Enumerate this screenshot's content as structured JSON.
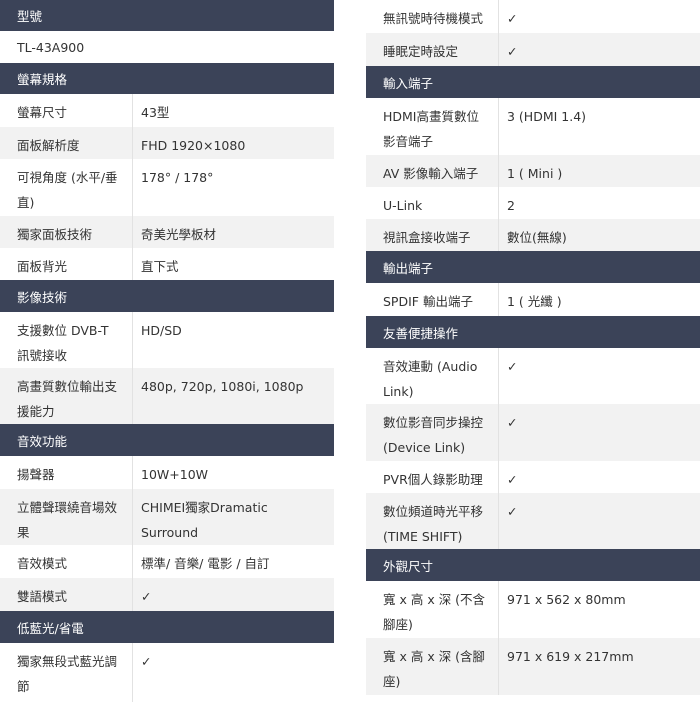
{
  "left": {
    "model": {
      "header": "型號",
      "value": "TL-43A900"
    },
    "sections": [
      {
        "header": "螢幕規格",
        "rows": [
          {
            "label": "螢幕尺寸",
            "value": "43型"
          },
          {
            "label": "面板解析度",
            "value": "FHD 1920×1080"
          },
          {
            "label": "可視角度 (水平/垂直)",
            "value": "178° / 178°"
          },
          {
            "label": "獨家面板技術",
            "value": "奇美光學板材"
          },
          {
            "label": "面板背光",
            "value": "直下式"
          }
        ]
      },
      {
        "header": "影像技術",
        "rows": [
          {
            "label": "支援數位 DVB-T 訊號接收",
            "value": "HD/SD"
          },
          {
            "label": "高畫質數位輸出支援能力",
            "value": "480p, 720p, 1080i, 1080p"
          }
        ]
      },
      {
        "header": "音效功能",
        "rows": [
          {
            "label": "揚聲器",
            "value": "10W+10W"
          },
          {
            "label": "立體聲環繞音場效果",
            "value": "CHIMEI獨家Dramatic Surround"
          },
          {
            "label": "音效模式",
            "value": "標準/ 音樂/ 電影 / 自訂"
          },
          {
            "label": "雙語模式",
            "value": "✓"
          }
        ]
      },
      {
        "header": "低藍光/省電",
        "rows": [
          {
            "label": "獨家無段式藍光調節",
            "value": "✓"
          }
        ]
      }
    ]
  },
  "right": {
    "top_rows": [
      {
        "label": "無訊號時待機模式",
        "value": "✓"
      },
      {
        "label": "睡眠定時設定",
        "value": "✓"
      }
    ],
    "sections": [
      {
        "header": "輸入端子",
        "rows": [
          {
            "label": "HDMI高畫質數位影音端子",
            "value": "3 (HDMI 1.4)"
          },
          {
            "label": "AV 影像輸入端子",
            "value": "1 ( Mini )"
          },
          {
            "label": "U-Link",
            "value": "2"
          },
          {
            "label": "視訊盒接收端子",
            "value": "數位(無線)"
          }
        ]
      },
      {
        "header": "輸出端子",
        "rows": [
          {
            "label": "SPDIF 輸出端子",
            "value": "1 ( 光纖 )"
          }
        ]
      },
      {
        "header": "友善便捷操作",
        "rows": [
          {
            "label": "音效連動 (Audio Link)",
            "value": "✓"
          },
          {
            "label": "數位影音同步操控 (Device Link)",
            "value": "✓"
          },
          {
            "label": "PVR個人錄影助理",
            "value": "✓"
          },
          {
            "label": "數位頻道時光平移 (TIME SHIFT)",
            "value": "✓"
          }
        ]
      },
      {
        "header": "外觀尺寸",
        "rows": [
          {
            "label": "寬 x 高 x 深 (不含腳座)",
            "value": "971 x 562 x 80mm"
          },
          {
            "label": "寬 x 高 x 深 (含腳座)",
            "value": "971 x 619 x 217mm"
          }
        ]
      }
    ]
  }
}
